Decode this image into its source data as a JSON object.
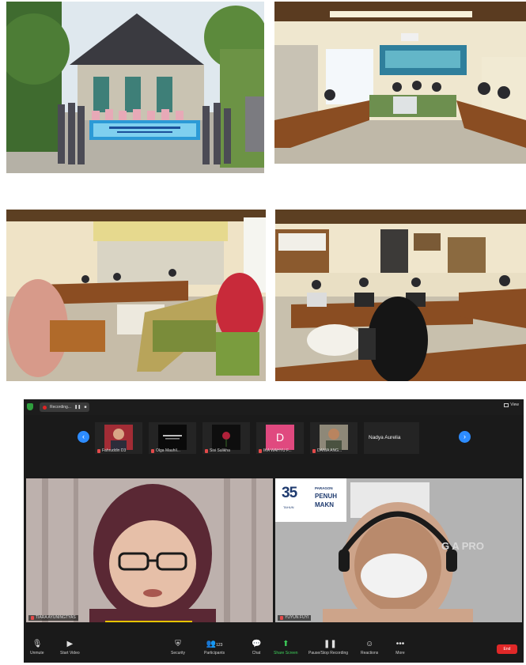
{
  "zoom": {
    "recording_label": "Recording...",
    "view_label": "View",
    "participants_strip": [
      {
        "name": "Fahruddin D3",
        "tile_color": "#7a2a2a",
        "initial": ""
      },
      {
        "name": "Olga Mauhil...",
        "tile_color": "#0a0a0a",
        "initial": ""
      },
      {
        "name": "Sisi Sulikha",
        "tile_color": "#0e0e0e",
        "initial": ""
      },
      {
        "name": "IKA WAHYU F...",
        "tile_color": "#e0497f",
        "initial": "D"
      },
      {
        "name": "DANIA ANG...",
        "tile_color": "#6c6a5e",
        "initial": ""
      },
      {
        "name": "Nadya Aurelia",
        "tile_color": "#242424",
        "initial": ""
      }
    ],
    "videos": [
      {
        "name": "TIARA AYUNINGTYAS"
      },
      {
        "name": "YUYUN FUYI"
      }
    ],
    "banner": {
      "number": "35",
      "sub": "TAHUN",
      "brand": "PARAGON",
      "line1": "PENUH",
      "line2": "MAKN",
      "overlay": "G A PRO"
    },
    "toolbar": {
      "unmute": "Unmute",
      "start_video": "Start Video",
      "security": "Security",
      "participants": "Participants",
      "participants_count": "123",
      "chat": "Chat",
      "share_screen": "Share Screen",
      "pause_recording": "Pause/Stop Recording",
      "reactions": "Reactions",
      "more": "More",
      "end": "End"
    }
  }
}
